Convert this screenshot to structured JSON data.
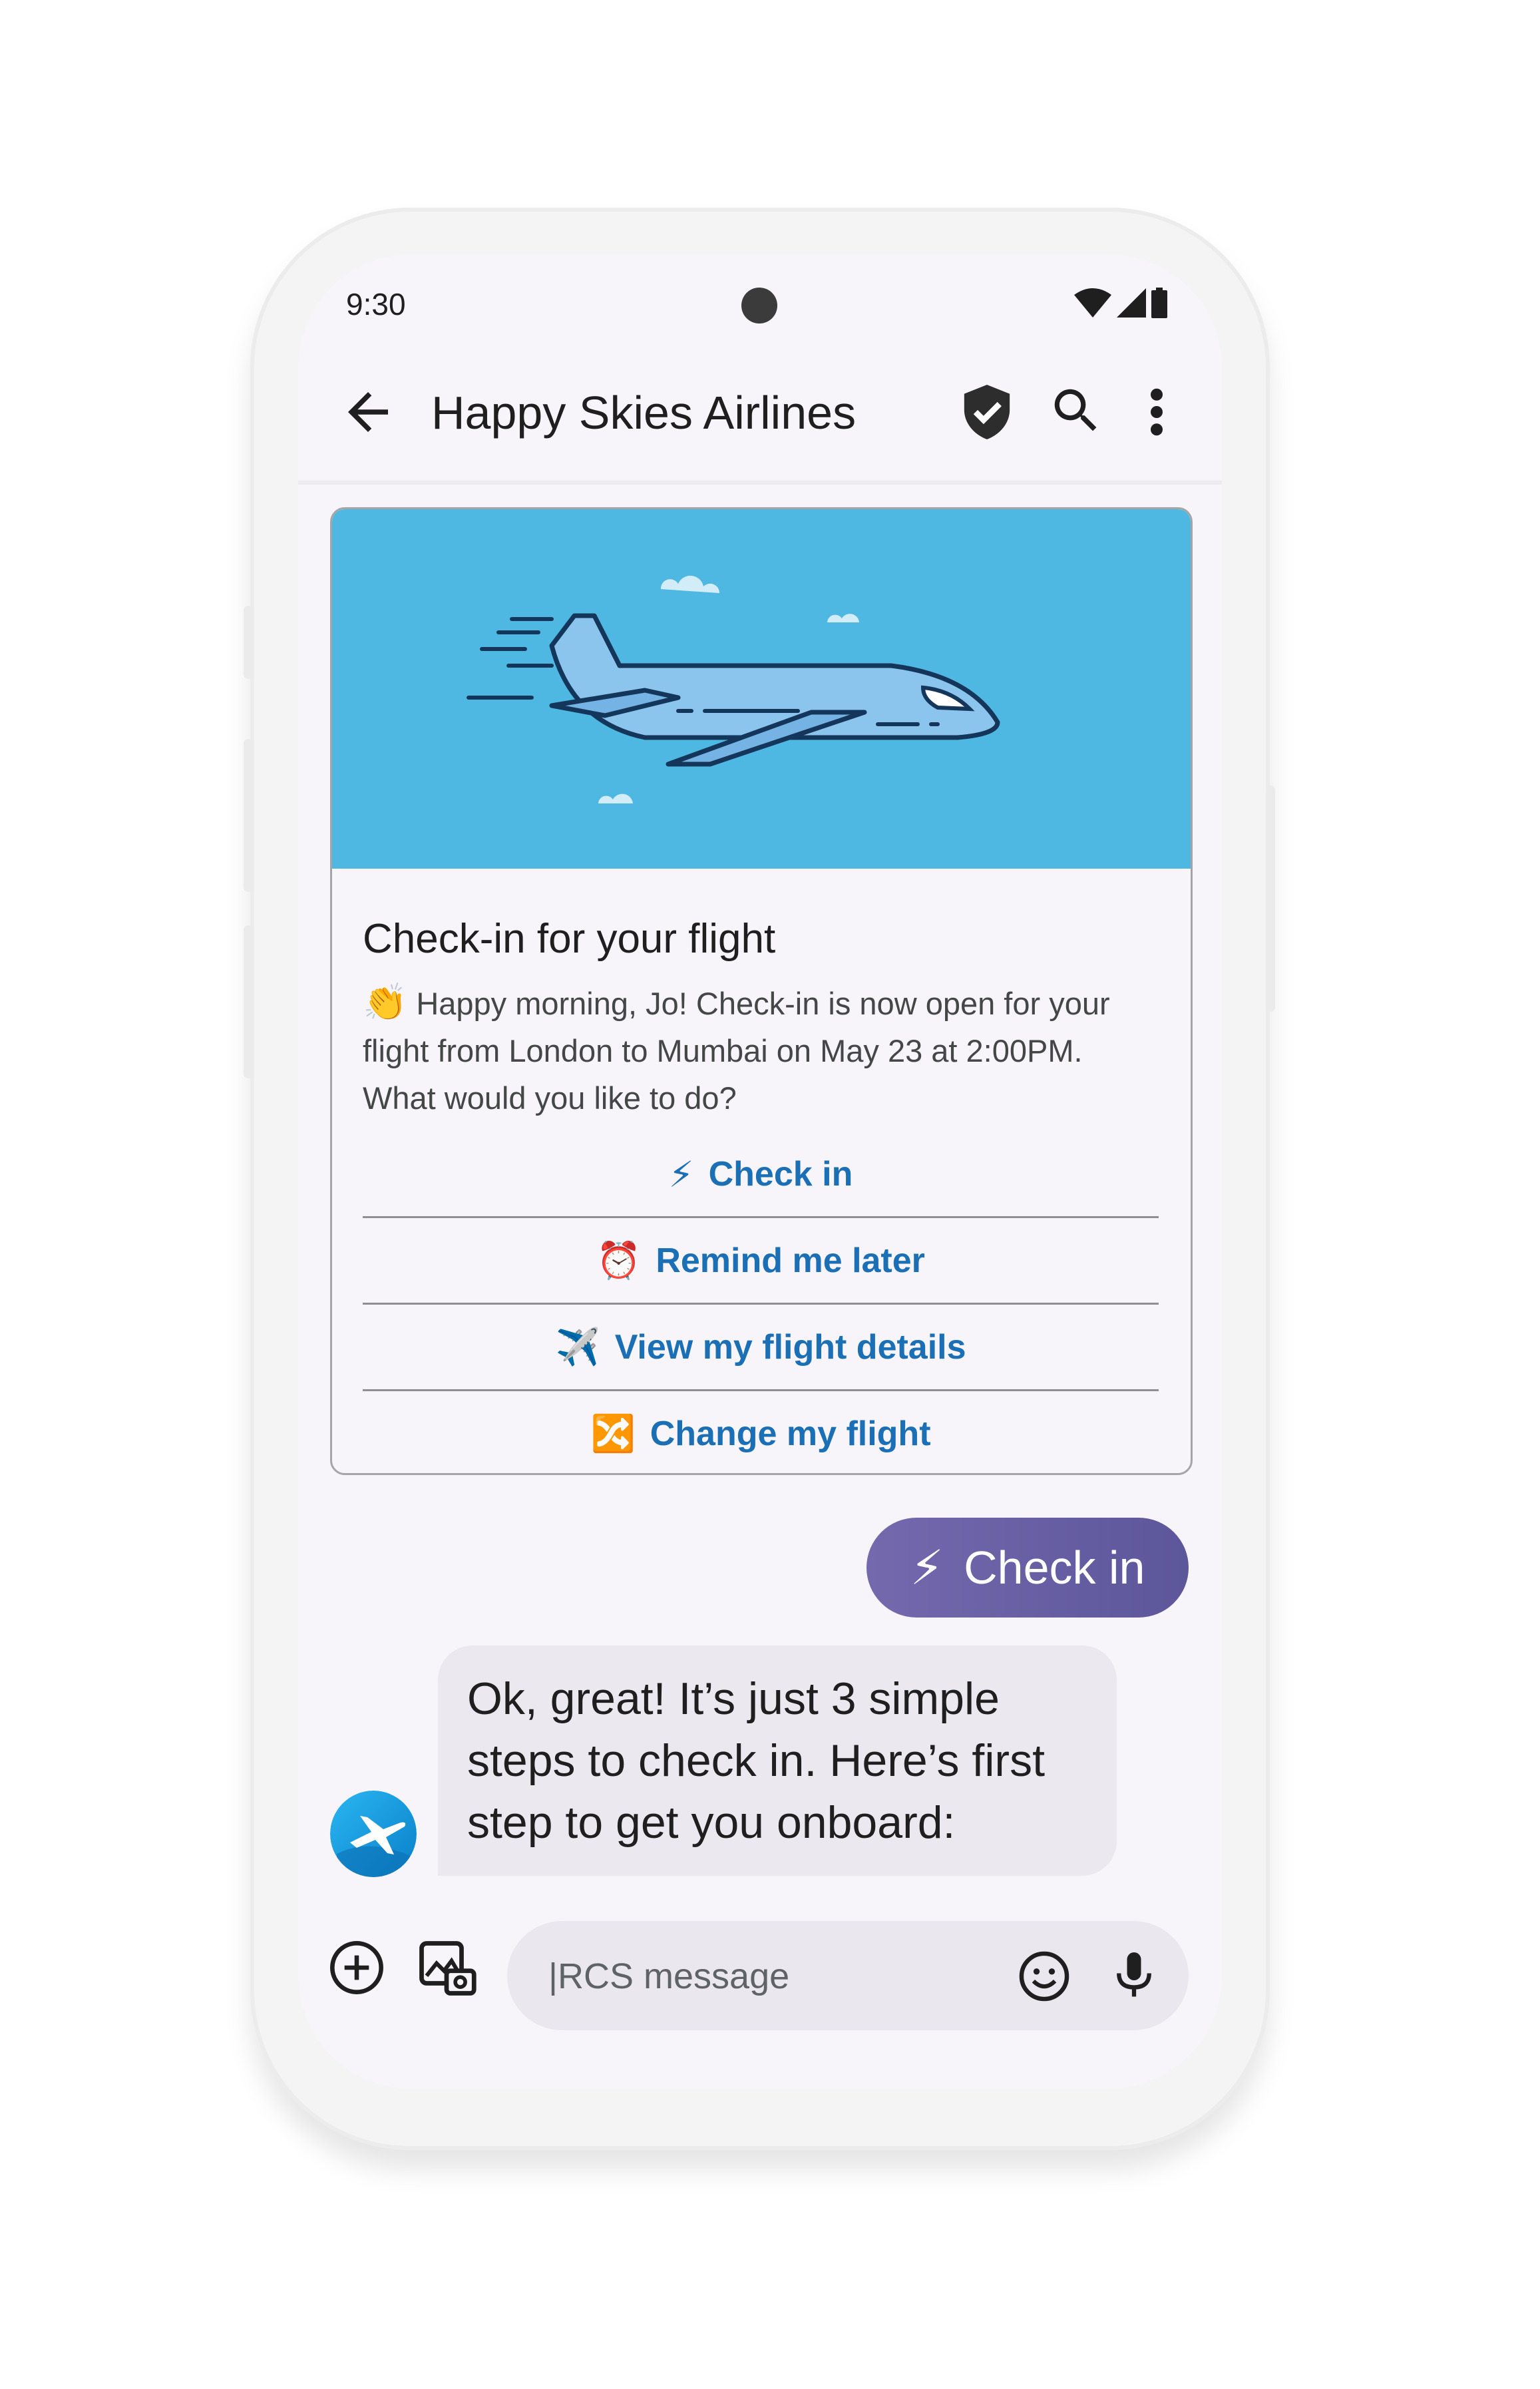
{
  "status_bar": {
    "time": "9:30"
  },
  "app_bar": {
    "title": "Happy Skies Airlines"
  },
  "rich_card": {
    "title": "Check-in for your flight",
    "description_emoji": "👏",
    "description": "Happy morning, Jo! Check-in is now open for your flight from London to Mumbai on May 23 at 2:00PM. What would you like to do?",
    "actions": [
      {
        "emoji": "⚡",
        "label": "Check in"
      },
      {
        "emoji": "⏰",
        "label": "Remind me later"
      },
      {
        "emoji": "✈️",
        "label": "View my flight details"
      },
      {
        "emoji": "🔀",
        "label": "Change my flight"
      }
    ]
  },
  "user_reply": {
    "emoji": "⚡",
    "label": "Check in"
  },
  "bot_message": {
    "text": "Ok, great! It’s just 3 simple steps to check in. Here’s first step to get you onboard:"
  },
  "compose": {
    "placeholder": "|RCS message"
  },
  "colors": {
    "accent": "#1a6fb5",
    "chip": "#6b62a8",
    "media_bg": "#4fb8e2"
  }
}
